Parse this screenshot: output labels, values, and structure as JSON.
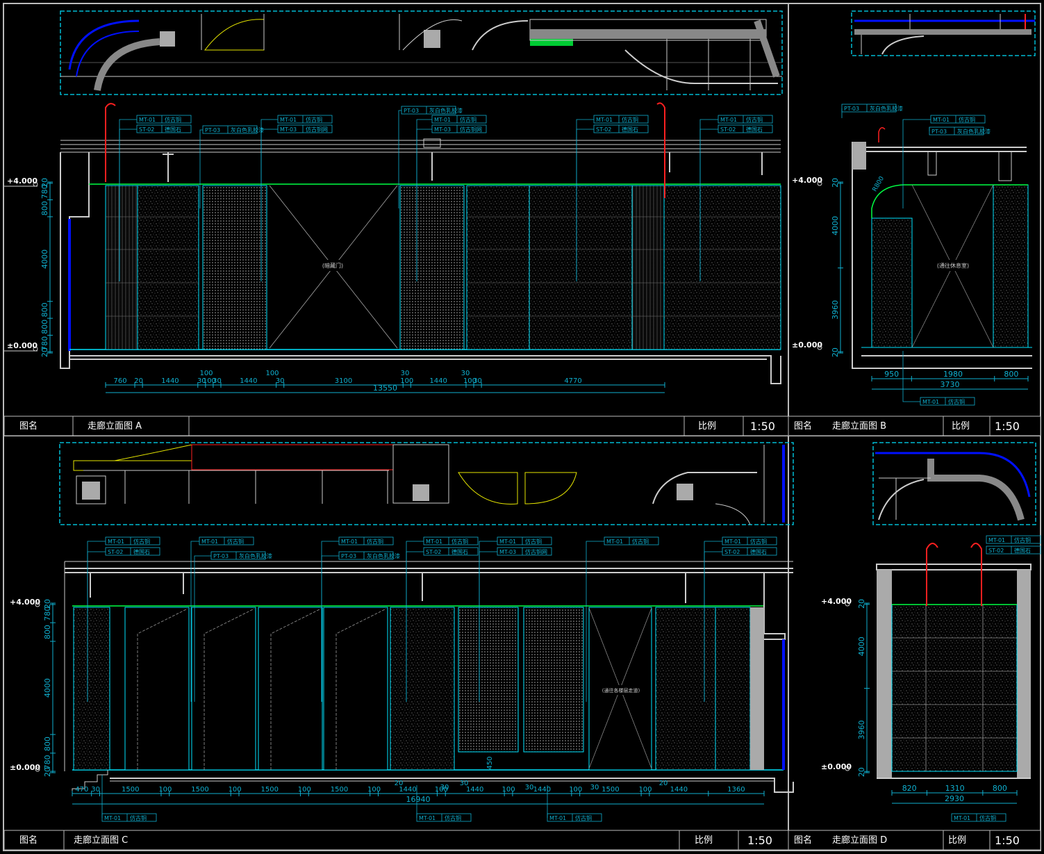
{
  "colors": {
    "background": "#000000",
    "frame": "#ffffff",
    "cyan": "#00e5ff",
    "green": "#00ff44",
    "blue": "#0010ff",
    "red": "#ff2020",
    "yellow": "#e6e600",
    "grey": "#aaaaaa",
    "dim_text": "#0fb0d0"
  },
  "panels": {
    "A": {
      "title_label": "图名",
      "title": "走廊立面图 A",
      "scale_label": "比例",
      "scale": "1:50",
      "level_top": "+4.000",
      "level_bottom": "±0.000",
      "vertical_dims": [
        "20",
        "780",
        "800",
        "4000",
        "800",
        "800",
        "780",
        "20"
      ],
      "bottom_dims": [
        "760",
        "20",
        "1440",
        "30",
        "100",
        "30",
        "1440",
        "30",
        "3100",
        "100",
        "1440",
        "100",
        "30",
        "4770"
      ],
      "top_dims": [
        "100",
        "100",
        "30",
        "30"
      ],
      "total": "13550",
      "door_note": "(暗藏门)",
      "tags": [
        {
          "code": "MT-01",
          "name": "仿古铜"
        },
        {
          "code": "ST-02",
          "name": "德国石"
        },
        {
          "code": "PT-03",
          "name": "灰白色乳胶漆"
        },
        {
          "code": "MT-01",
          "name": "仿古铜"
        },
        {
          "code": "MT-03",
          "name": "仿古铜网"
        },
        {
          "code": "PT-03",
          "name": "灰白色乳胶漆"
        },
        {
          "code": "MT-01",
          "name": "仿古铜"
        },
        {
          "code": "MT-03",
          "name": "仿古铜网"
        },
        {
          "code": "MT-01",
          "name": "仿古铜"
        },
        {
          "code": "ST-02",
          "name": "德国石"
        },
        {
          "code": "MT-01",
          "name": "仿古铜"
        },
        {
          "code": "ST-02",
          "name": "德国石"
        }
      ]
    },
    "B": {
      "title_label": "图名",
      "title": "走廊立面图 B",
      "scale_label": "比例",
      "scale": "1:50",
      "level_top": "+4.000",
      "level_bottom": "±0.000",
      "vertical_dims": [
        "20",
        "4000",
        "3960",
        "20"
      ],
      "bottom_dims": [
        "950",
        "1980",
        "800"
      ],
      "total": "3730",
      "arc_label": "R800",
      "door_note": "(通往休息室)",
      "tags": [
        {
          "code": "PT-03",
          "name": "灰白色乳胶漆"
        },
        {
          "code": "MT-01",
          "name": "仿古铜"
        },
        {
          "code": "PT-03",
          "name": "灰白色乳胶漆"
        },
        {
          "code": "MT-01",
          "name": "仿古铜"
        }
      ]
    },
    "C": {
      "title_label": "图名",
      "title": "走廊立面图 C",
      "scale_label": "比例",
      "scale": "1:50",
      "level_top": "+4.000",
      "level_bottom": "±0.000",
      "vertical_dims": [
        "20",
        "780",
        "800",
        "4000",
        "800",
        "780",
        "20"
      ],
      "bottom_dims": [
        "470",
        "30",
        "1500",
        "100",
        "1500",
        "100",
        "1500",
        "100",
        "1500",
        "100",
        "1440",
        "100",
        "1440",
        "100",
        "1440",
        "100",
        "1500",
        "100",
        "1440",
        "1360"
      ],
      "extra_dims": [
        "450",
        "20",
        "30",
        "30",
        "30",
        "30",
        "20"
      ],
      "total": "16940",
      "door_note": "(通往各楼层走道)",
      "tags": [
        {
          "code": "MT-01",
          "name": "仿古铜"
        },
        {
          "code": "ST-02",
          "name": "德国石"
        },
        {
          "code": "MT-01",
          "name": "仿古铜"
        },
        {
          "code": "PT-03",
          "name": "灰白色乳胶漆"
        },
        {
          "code": "MT-01",
          "name": "仿古铜"
        },
        {
          "code": "PT-03",
          "name": "灰白色乳胶漆"
        },
        {
          "code": "MT-01",
          "name": "仿古铜"
        },
        {
          "code": "ST-02",
          "name": "德国石"
        },
        {
          "code": "MT-01",
          "name": "仿古铜"
        },
        {
          "code": "MT-03",
          "name": "仿古铜网"
        },
        {
          "code": "MT-01",
          "name": "仿古铜"
        },
        {
          "code": "MT-01",
          "name": "仿古铜"
        },
        {
          "code": "ST-02",
          "name": "德国石"
        },
        {
          "code": "MT-01",
          "name": "仿古铜"
        },
        {
          "code": "MT-01",
          "name": "仿古铜"
        },
        {
          "code": "MT-01",
          "name": "仿古铜"
        }
      ]
    },
    "D": {
      "title_label": "图名",
      "title": "走廊立面图 D",
      "scale_label": "比例",
      "scale": "1:50",
      "level_top": "+4.000",
      "level_bottom": "±0.000",
      "vertical_dims": [
        "20",
        "4000",
        "3960",
        "20"
      ],
      "bottom_dims": [
        "820",
        "1310",
        "800"
      ],
      "total": "2930",
      "tags": [
        {
          "code": "MT-01",
          "name": "仿古铜"
        },
        {
          "code": "ST-02",
          "name": "德国石"
        },
        {
          "code": "MT-01",
          "name": "仿古铜"
        }
      ]
    }
  }
}
